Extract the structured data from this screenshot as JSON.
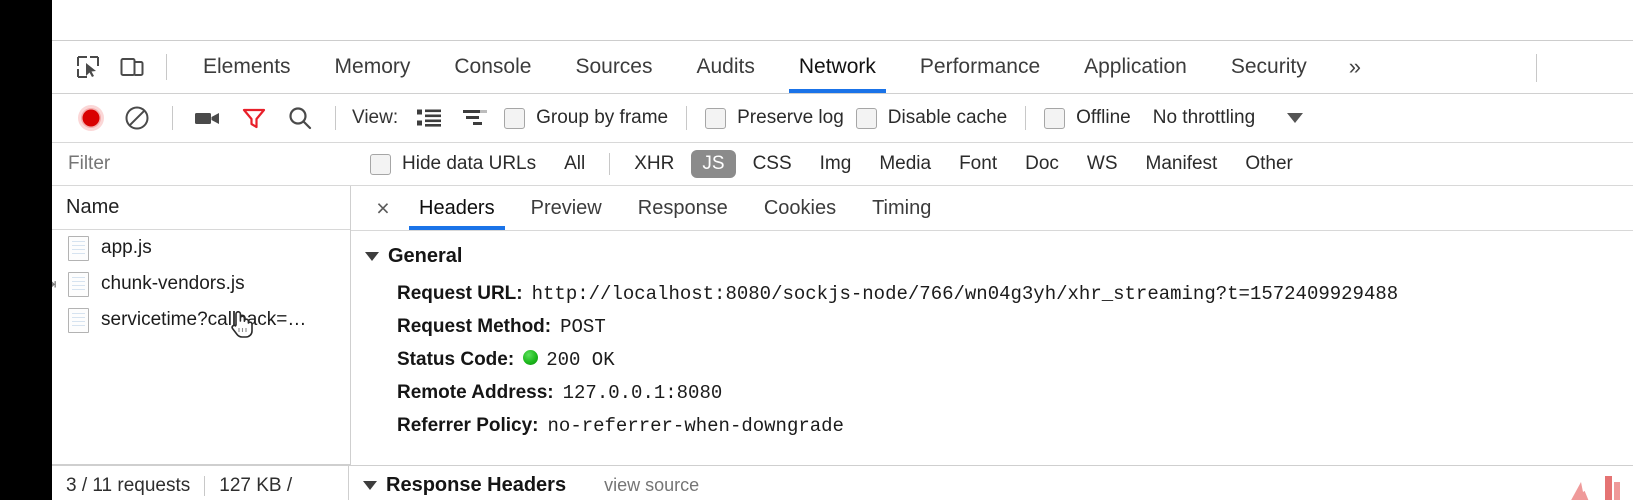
{
  "tabbar": {
    "inspect_icon": "inspect-element-icon",
    "device_icon": "device-toolbar-icon",
    "tabs": [
      {
        "label": "Elements",
        "active": false
      },
      {
        "label": "Memory",
        "active": false
      },
      {
        "label": "Console",
        "active": false
      },
      {
        "label": "Sources",
        "active": false
      },
      {
        "label": "Audits",
        "active": false
      },
      {
        "label": "Network",
        "active": true
      },
      {
        "label": "Performance",
        "active": false
      },
      {
        "label": "Application",
        "active": false
      },
      {
        "label": "Security",
        "active": false
      }
    ],
    "overflow": "»"
  },
  "toolbar": {
    "record_icon": "record-button-icon",
    "clear_icon": "clear-icon",
    "capture_icon": "capture-screenshots-icon",
    "filter_icon": "filter-icon",
    "search_icon": "search-icon",
    "view_label": "View:",
    "list_view_icon": "list-view-icon",
    "waterfall_view_icon": "waterfall-view-icon",
    "group_by_frame": "Group by frame",
    "preserve_log": "Preserve log",
    "disable_cache": "Disable cache",
    "offline": "Offline",
    "throttling": "No throttling",
    "throttle_caret": "caret-down-icon"
  },
  "filterbar": {
    "filter_placeholder": "Filter",
    "filter_value": "",
    "hide_data_urls": "Hide data URLs",
    "types": [
      {
        "label": "All",
        "selected": false
      },
      {
        "label": "XHR",
        "selected": false
      },
      {
        "label": "JS",
        "selected": true
      },
      {
        "label": "CSS",
        "selected": false
      },
      {
        "label": "Img",
        "selected": false
      },
      {
        "label": "Media",
        "selected": false
      },
      {
        "label": "Font",
        "selected": false
      },
      {
        "label": "Doc",
        "selected": false
      },
      {
        "label": "WS",
        "selected": false
      },
      {
        "label": "Manifest",
        "selected": false
      },
      {
        "label": "Other",
        "selected": false
      }
    ]
  },
  "requests": {
    "column_header": "Name",
    "rows": [
      {
        "name": "app.js",
        "icon": "document-icon",
        "marked": false
      },
      {
        "name": "chunk-vendors.js",
        "icon": "document-icon",
        "marked": true
      },
      {
        "name": "servicetime?callback=…",
        "icon": "document-icon",
        "marked": false
      }
    ]
  },
  "detail": {
    "close_label": "×",
    "tabs": [
      {
        "label": "Headers",
        "active": true
      },
      {
        "label": "Preview",
        "active": false
      },
      {
        "label": "Response",
        "active": false
      },
      {
        "label": "Cookies",
        "active": false
      },
      {
        "label": "Timing",
        "active": false
      }
    ],
    "general": {
      "title": "General",
      "rows": [
        {
          "key": "Request URL:",
          "value": "http://localhost:8080/sockjs-node/766/wn04g3yh/xhr_streaming?t=1572409929488",
          "status_dot": false
        },
        {
          "key": "Request Method:",
          "value": "POST",
          "status_dot": false
        },
        {
          "key": "Status Code:",
          "value": "200 OK",
          "status_dot": true
        },
        {
          "key": "Remote Address:",
          "value": "127.0.0.1:8080",
          "status_dot": false
        },
        {
          "key": "Referrer Policy:",
          "value": "no-referrer-when-downgrade",
          "status_dot": false
        }
      ]
    },
    "response_headers_title": "Response Headers",
    "view_source": "view source"
  },
  "statusbar": {
    "requests": "3 / 11 requests",
    "transferred": "127 KB /"
  },
  "colors": {
    "accent_blue": "#1a73e8",
    "record_red": "#d93025",
    "filter_red": "#e8202a",
    "status_green": "#1db91d",
    "selected_pill": "#8b8b8b"
  }
}
